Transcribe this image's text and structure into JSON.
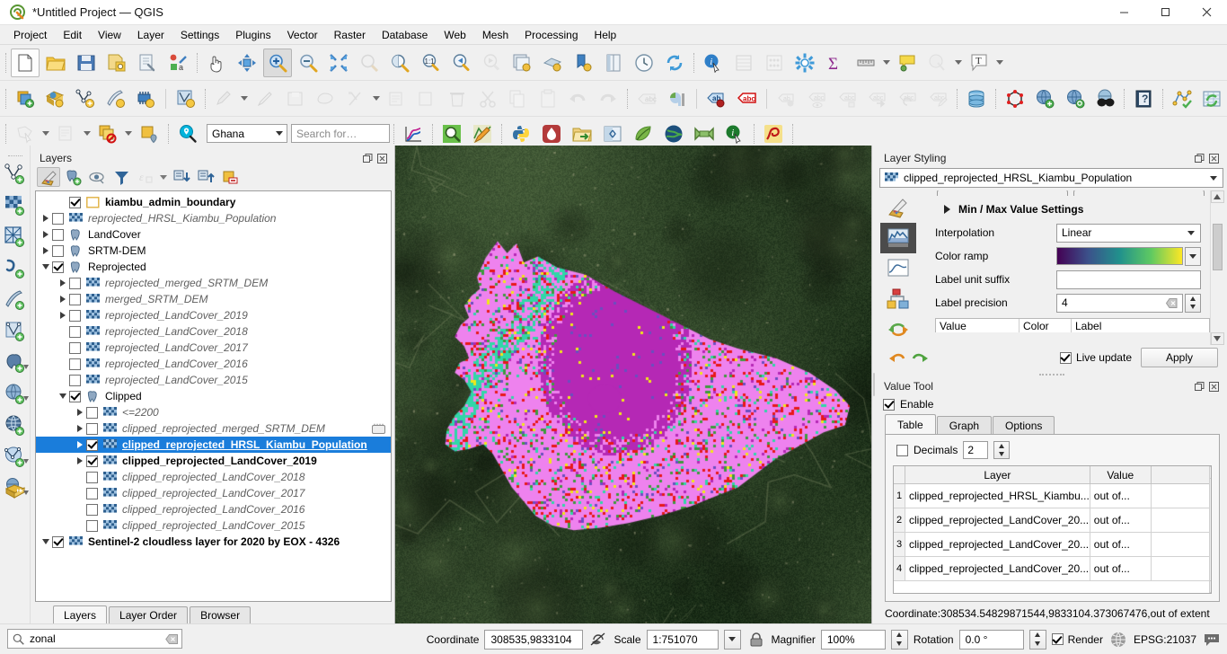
{
  "window": {
    "title": "*Untitled Project — QGIS",
    "app_icon": "qgis-logo-icon",
    "minimize": "–",
    "maximize": "□",
    "close": "✕"
  },
  "menubar": {
    "items": [
      {
        "label": "Project",
        "mnemonic": "P"
      },
      {
        "label": "Edit",
        "mnemonic": "E"
      },
      {
        "label": "View",
        "mnemonic": "V"
      },
      {
        "label": "Layer",
        "mnemonic": "L"
      },
      {
        "label": "Settings",
        "mnemonic": "S"
      },
      {
        "label": "Plugins",
        "mnemonic": "P"
      },
      {
        "label": "Vector",
        "mnemonic": "o"
      },
      {
        "label": "Raster",
        "mnemonic": "R"
      },
      {
        "label": "Database",
        "mnemonic": "D"
      },
      {
        "label": "Web",
        "mnemonic": "W"
      },
      {
        "label": "Mesh",
        "mnemonic": "M"
      },
      {
        "label": "Processing",
        "mnemonic": "c"
      },
      {
        "label": "Help",
        "mnemonic": "H"
      }
    ]
  },
  "toolbar_row1": {
    "buttons": [
      "new-project-icon",
      "open-project-icon",
      "save-project-icon",
      "save-project-as-icon",
      "project-properties-icon",
      "style-manager-icon",
      "pan-map-icon",
      "pan-to-selection-icon",
      "zoom-in-icon",
      "zoom-out-icon",
      "zoom-full-icon",
      "zoom-to-selection-icon",
      "zoom-to-layer-icon",
      "zoom-native-icon",
      "zoom-last-icon",
      "zoom-next-icon",
      "new-map-view-icon",
      "new-3d-map-view-icon",
      "new-print-layout-icon",
      "layout-manager-icon",
      "temporal-controller-icon",
      "refresh-icon",
      "identify-features-icon",
      "open-attribute-table-icon",
      "field-calculator-icon",
      "processing-toolbox-icon",
      "statistical-summary-icon",
      "measure-line-icon",
      "map-tips-icon",
      "show-unplaced-labels-icon",
      "text-annotation-icon"
    ],
    "active": "zoom-in-icon"
  },
  "toolbar_row2": {
    "buttons": [
      "add-layer-icon",
      "add-raster-layer-icon",
      "add-vector-layer-icon",
      "add-delimited-text-icon",
      "add-mesh-layer-icon",
      "new-virtual-layer-icon",
      "current-edits-icon",
      "toggle-editing-icon",
      "save-layer-edits-icon",
      "add-feature-icon",
      "vertex-tool-icon",
      "modify-attributes-icon",
      "merge-features-icon",
      "delete-selected-icon",
      "cut-features-icon",
      "copy-features-icon",
      "paste-features-icon",
      "undo-icon",
      "redo-icon",
      "label-icon",
      "diagram-icon",
      "pin-labels-icon",
      "highlight-labels-icon",
      "move-label-icon",
      "show-hide-labels-icon",
      "rotate-label-icon",
      "change-label-icon",
      "revert-label-icon",
      "edit-label-icon",
      "db-manager-icon",
      "topology-checker-icon",
      "metasearch-icon",
      "qgis-browser-icon",
      "osm-place-search-icon",
      "help-icon",
      "network-analysis-icon",
      "refresh-data-icon"
    ]
  },
  "toolbar_row3": {
    "buttons": [
      "select-features-icon",
      "select-by-expression-icon",
      "deselect-features-icon",
      "select-value-icon",
      "quick-osm-search-icon"
    ],
    "country_combo": {
      "value": "Ghana"
    },
    "search_field": {
      "placeholder": "Search for…",
      "value": ""
    },
    "buttons_right": [
      "plot-icon",
      "zoom-search-icon",
      "map-editing-icon",
      "python-console-icon",
      "qfield-icon",
      "open-data-source-icon",
      "compare-view-icon",
      "leaf-plugin-icon",
      "globe-plugin-icon",
      "mesh-plugin-icon",
      "info-plugin-icon",
      "freehand-plugin-icon"
    ]
  },
  "left_vtoolbar": {
    "buttons": [
      "add-vector-layer-icon",
      "add-raster-layer-icon",
      "add-mesh-layer-icon",
      "add-delimited-text-layer-icon",
      "add-spatialite-layer-icon",
      "add-virtual-layer-icon",
      "add-postgis-layer-icon",
      "add-wms-layer-icon",
      "add-wfs-layer-icon",
      "add-wcs-layer-icon",
      "add-arcgis-layer-icon"
    ]
  },
  "layers_panel": {
    "title": "Layers",
    "dock_buttons": [
      "float-icon",
      "close-icon"
    ],
    "toolbar": [
      "open-layer-styling-icon",
      "add-group-icon",
      "manage-visibility-icon",
      "filter-legend-icon",
      "filter-legend-expression-icon",
      "expand-all-icon",
      "collapse-all-icon",
      "remove-layer-icon"
    ],
    "tree": [
      {
        "indent": 1,
        "expand": "none",
        "checked": true,
        "icon": "polygon-layer-icon",
        "label": "kiambu_admin_boundary",
        "style": "bold",
        "selected": false
      },
      {
        "indent": 0,
        "expand": "right",
        "checked": false,
        "icon": "raster-layer-icon",
        "label": "reprojected_HRSL_Kiambu_Population",
        "style": "italic",
        "selected": false
      },
      {
        "indent": 0,
        "expand": "right",
        "checked": false,
        "icon": "group-icon",
        "label": "LandCover",
        "style": "normal",
        "selected": false
      },
      {
        "indent": 0,
        "expand": "right",
        "checked": false,
        "icon": "group-icon",
        "label": "SRTM-DEM",
        "style": "normal",
        "selected": false
      },
      {
        "indent": 0,
        "expand": "down",
        "checked": true,
        "icon": "group-icon",
        "label": "Reprojected",
        "style": "normal",
        "selected": false
      },
      {
        "indent": 1,
        "expand": "right",
        "checked": false,
        "icon": "raster-layer-icon",
        "label": "reprojected_merged_SRTM_DEM",
        "style": "italic",
        "selected": false
      },
      {
        "indent": 1,
        "expand": "right",
        "checked": false,
        "icon": "raster-layer-icon",
        "label": "merged_SRTM_DEM",
        "style": "italic",
        "selected": false
      },
      {
        "indent": 1,
        "expand": "right",
        "checked": false,
        "icon": "raster-layer-icon",
        "label": "reprojected_LandCover_2019",
        "style": "italic",
        "selected": false
      },
      {
        "indent": 1,
        "expand": "none",
        "checked": false,
        "icon": "raster-layer-icon",
        "label": "reprojected_LandCover_2018",
        "style": "italic",
        "selected": false
      },
      {
        "indent": 1,
        "expand": "none",
        "checked": false,
        "icon": "raster-layer-icon",
        "label": "reprojected_LandCover_2017",
        "style": "italic",
        "selected": false
      },
      {
        "indent": 1,
        "expand": "none",
        "checked": false,
        "icon": "raster-layer-icon",
        "label": "reprojected_LandCover_2016",
        "style": "italic",
        "selected": false
      },
      {
        "indent": 1,
        "expand": "none",
        "checked": false,
        "icon": "raster-layer-icon",
        "label": "reprojected_LandCover_2015",
        "style": "italic",
        "selected": false
      },
      {
        "indent": 1,
        "expand": "down",
        "checked": true,
        "icon": "group-icon",
        "label": "Clipped",
        "style": "normal",
        "selected": false
      },
      {
        "indent": 2,
        "expand": "right",
        "checked": false,
        "icon": "raster-layer-icon",
        "label": "<=2200",
        "style": "italic",
        "selected": false
      },
      {
        "indent": 2,
        "expand": "right",
        "checked": false,
        "icon": "raster-layer-icon",
        "label": "clipped_reprojected_merged_SRTM_DEM",
        "style": "italic",
        "selected": false,
        "extra": "edit-indicator-icon"
      },
      {
        "indent": 2,
        "expand": "right",
        "checked": true,
        "icon": "raster-layer-icon",
        "label": "clipped_reprojected_HRSL_Kiambu_Population",
        "style": "underline",
        "selected": true
      },
      {
        "indent": 2,
        "expand": "right",
        "checked": true,
        "icon": "raster-layer-icon",
        "label": "clipped_reprojected_LandCover_2019",
        "style": "bold",
        "selected": false
      },
      {
        "indent": 2,
        "expand": "none",
        "checked": false,
        "icon": "raster-layer-icon",
        "label": "clipped_reprojected_LandCover_2018",
        "style": "italic",
        "selected": false
      },
      {
        "indent": 2,
        "expand": "none",
        "checked": false,
        "icon": "raster-layer-icon",
        "label": "clipped_reprojected_LandCover_2017",
        "style": "italic",
        "selected": false
      },
      {
        "indent": 2,
        "expand": "none",
        "checked": false,
        "icon": "raster-layer-icon",
        "label": "clipped_reprojected_LandCover_2016",
        "style": "italic",
        "selected": false
      },
      {
        "indent": 2,
        "expand": "none",
        "checked": false,
        "icon": "raster-layer-icon",
        "label": "clipped_reprojected_LandCover_2015",
        "style": "italic",
        "selected": false
      },
      {
        "indent": 0,
        "expand": "down",
        "checked": true,
        "icon": "raster-layer-icon",
        "label": "Sentinel-2 cloudless layer for 2020 by EOX - 4326",
        "style": "bold",
        "selected": false
      }
    ],
    "tabs": [
      {
        "label": "Layers",
        "active": true
      },
      {
        "label": "Layer Order",
        "active": false
      },
      {
        "label": "Browser",
        "active": false
      }
    ],
    "filter": {
      "value": "zonal",
      "icon": "search-icon",
      "clear_icon": "clear-icon"
    }
  },
  "layer_styling": {
    "title": "Layer Styling",
    "dock_buttons": [
      "float-icon",
      "close-icon"
    ],
    "layer_combo": {
      "value": "clipped_reprojected_HRSL_Kiambu_Population",
      "icon": "raster-layer-icon"
    },
    "sidebar_icons": [
      "symbology-icon",
      "histogram-icon",
      "transparency-icon",
      "histogram-chart-icon",
      "rendering-icon",
      "undo-history-icon"
    ],
    "section_header": "Min / Max Value Settings",
    "fields": [
      {
        "label": "Interpolation",
        "value": "Linear",
        "type": "combo"
      },
      {
        "label": "Color ramp",
        "value": "",
        "type": "ramp"
      },
      {
        "label": "Label unit suffix",
        "value": "",
        "type": "text"
      },
      {
        "label": "Label precision",
        "value": "4",
        "type": "spin"
      }
    ],
    "table_headers": [
      "Value",
      "Color",
      "Label"
    ],
    "undo_icon": "undo-arrow-icon",
    "redo_icon": "redo-arrow-icon",
    "live_update": {
      "label": "Live update",
      "checked": true
    },
    "apply_button": "Apply",
    "color_ramp_stops": [
      "#440154",
      "#3b528b",
      "#21918c",
      "#5ec962",
      "#fde725"
    ]
  },
  "value_tool": {
    "title": "Value Tool",
    "dock_buttons": [
      "float-icon",
      "close-icon"
    ],
    "enable": {
      "label": "Enable",
      "checked": true
    },
    "tabs": [
      {
        "label": "Table",
        "active": true
      },
      {
        "label": "Graph",
        "active": false
      },
      {
        "label": "Options",
        "active": false
      }
    ],
    "decimals": {
      "label": "Decimals",
      "checked": false,
      "value": "2"
    },
    "table": {
      "headers": [
        "Layer",
        "Value"
      ],
      "rows": [
        {
          "index": "1",
          "layer": "clipped_reprojected_HRSL_Kiambu...",
          "value": "out of..."
        },
        {
          "index": "2",
          "layer": "clipped_reprojected_LandCover_20...",
          "value": "out of..."
        },
        {
          "index": "3",
          "layer": "clipped_reprojected_LandCover_20...",
          "value": "out of..."
        },
        {
          "index": "4",
          "layer": "clipped_reprojected_LandCover_20...",
          "value": "out of..."
        }
      ]
    },
    "coordinate_text": "Coordinate:308534.54829871544,9833104.373067476,out of extent"
  },
  "statusbar": {
    "coordinate_label": "Coordinate",
    "coordinate_value": "308535,9833104",
    "lock_extent_icon": "lock-extent-icon",
    "scale_label": "Scale",
    "scale_value": "1:751070",
    "scale_lock_icon": "scale-lock-icon",
    "magnifier_label": "Magnifier",
    "magnifier_value": "100%",
    "rotation_label": "Rotation",
    "rotation_value": "0.0 °",
    "render_label": "Render",
    "render_checked": true,
    "crs_label": "EPSG:21037",
    "crs_icon": "globe-crs-icon",
    "messages_icon": "messages-icon"
  },
  "map": {
    "basemap": "Sentinel-2 cloudless satellite imagery",
    "colors": {
      "background_dark_green": "#2d4226",
      "landcover_magenta": "#ee82ee",
      "landcover_purple": "#b528b5",
      "landcover_teal": "#31d6a8",
      "landcover_orange": "#f0a818",
      "landcover_red": "#e81818",
      "landcover_yellow": "#f0e818"
    }
  }
}
